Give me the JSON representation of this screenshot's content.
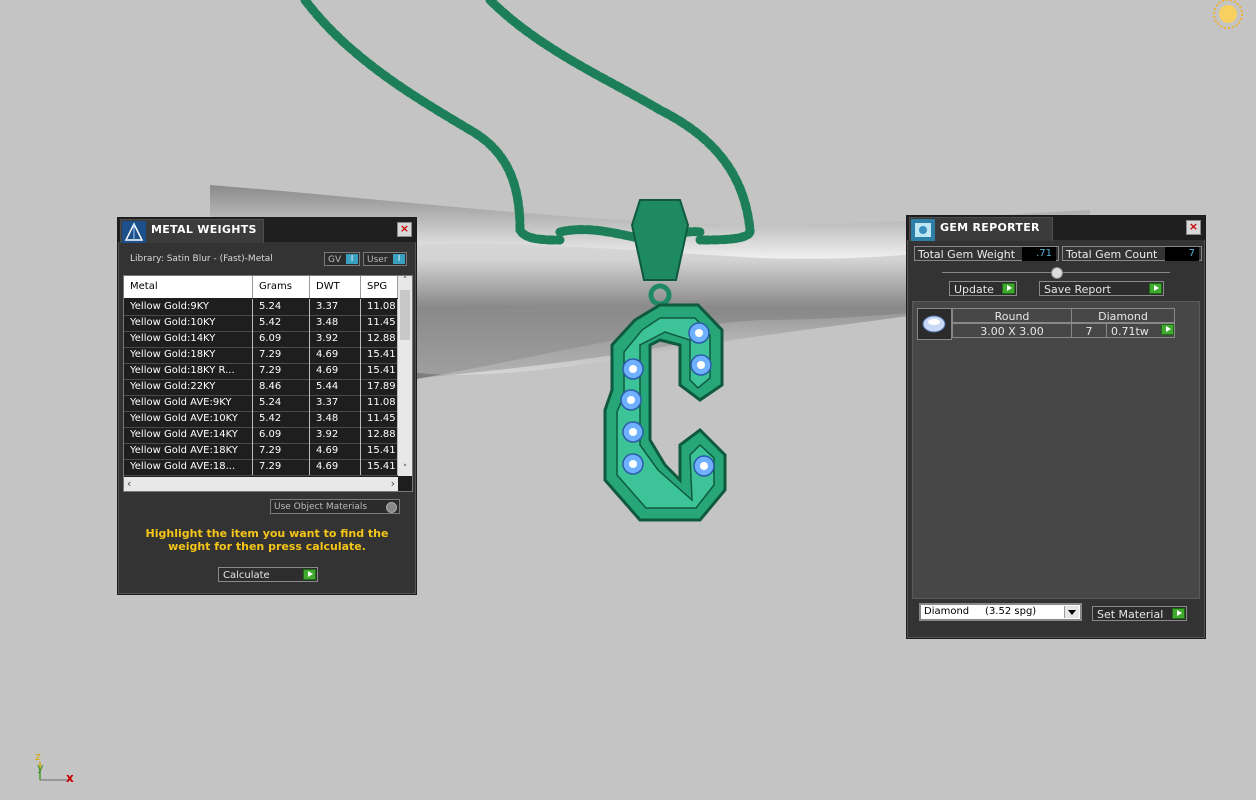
{
  "metal_weights": {
    "title": "METAL WEIGHTS",
    "library": "Library: Satin Blur - (Fast)-Metal",
    "toggle_gv": "GV",
    "toggle_user": "User",
    "columns": [
      "Metal",
      "Grams",
      "DWT",
      "SPG"
    ],
    "rows": [
      {
        "metal": "Yellow Gold:9KY",
        "grams": "5.24",
        "dwt": "3.37",
        "spg": "11.08"
      },
      {
        "metal": "Yellow Gold:10KY",
        "grams": "5.42",
        "dwt": "3.48",
        "spg": "11.45"
      },
      {
        "metal": "Yellow Gold:14KY",
        "grams": "6.09",
        "dwt": "3.92",
        "spg": "12.88"
      },
      {
        "metal": "Yellow Gold:18KY",
        "grams": "7.29",
        "dwt": "4.69",
        "spg": "15.41"
      },
      {
        "metal": "Yellow Gold:18KY R...",
        "grams": "7.29",
        "dwt": "4.69",
        "spg": "15.41"
      },
      {
        "metal": "Yellow Gold:22KY",
        "grams": "8.46",
        "dwt": "5.44",
        "spg": "17.89"
      },
      {
        "metal": "Yellow Gold AVE:9KY",
        "grams": "5.24",
        "dwt": "3.37",
        "spg": "11.08"
      },
      {
        "metal": "Yellow Gold AVE:10KY",
        "grams": "5.42",
        "dwt": "3.48",
        "spg": "11.45"
      },
      {
        "metal": "Yellow Gold AVE:14KY",
        "grams": "6.09",
        "dwt": "3.92",
        "spg": "12.88"
      },
      {
        "metal": "Yellow Gold AVE:18KY",
        "grams": "7.29",
        "dwt": "4.69",
        "spg": "15.41"
      },
      {
        "metal": "Yellow Gold AVE:18...",
        "grams": "7.29",
        "dwt": "4.69",
        "spg": "15.41"
      }
    ],
    "use_object_materials": "Use Object Materials",
    "hint": "Highlight the item you want to find the weight for then press calculate.",
    "calculate": "Calculate"
  },
  "gem_reporter": {
    "title": "GEM REPORTER",
    "total_weight_label": "Total Gem Weight",
    "total_weight_value": ".71",
    "total_count_label": "Total Gem Count",
    "total_count_value": "7",
    "update": "Update",
    "save_report": "Save Report",
    "gem": {
      "shape": "Round",
      "material": "Diamond",
      "size": "3.00 X 3.00",
      "count": "7",
      "weight": "0.71tw"
    },
    "material_select": "Diamond     (3.52 spg)",
    "set_material": "Set Material"
  },
  "axis": {
    "x": "x",
    "y": "y",
    "z": "z"
  },
  "colors": {
    "panel_bg": "#333333",
    "metal_green": "#1f8a62",
    "hint_yellow": "#f5c518",
    "value_blue": "#5ab4d6"
  }
}
